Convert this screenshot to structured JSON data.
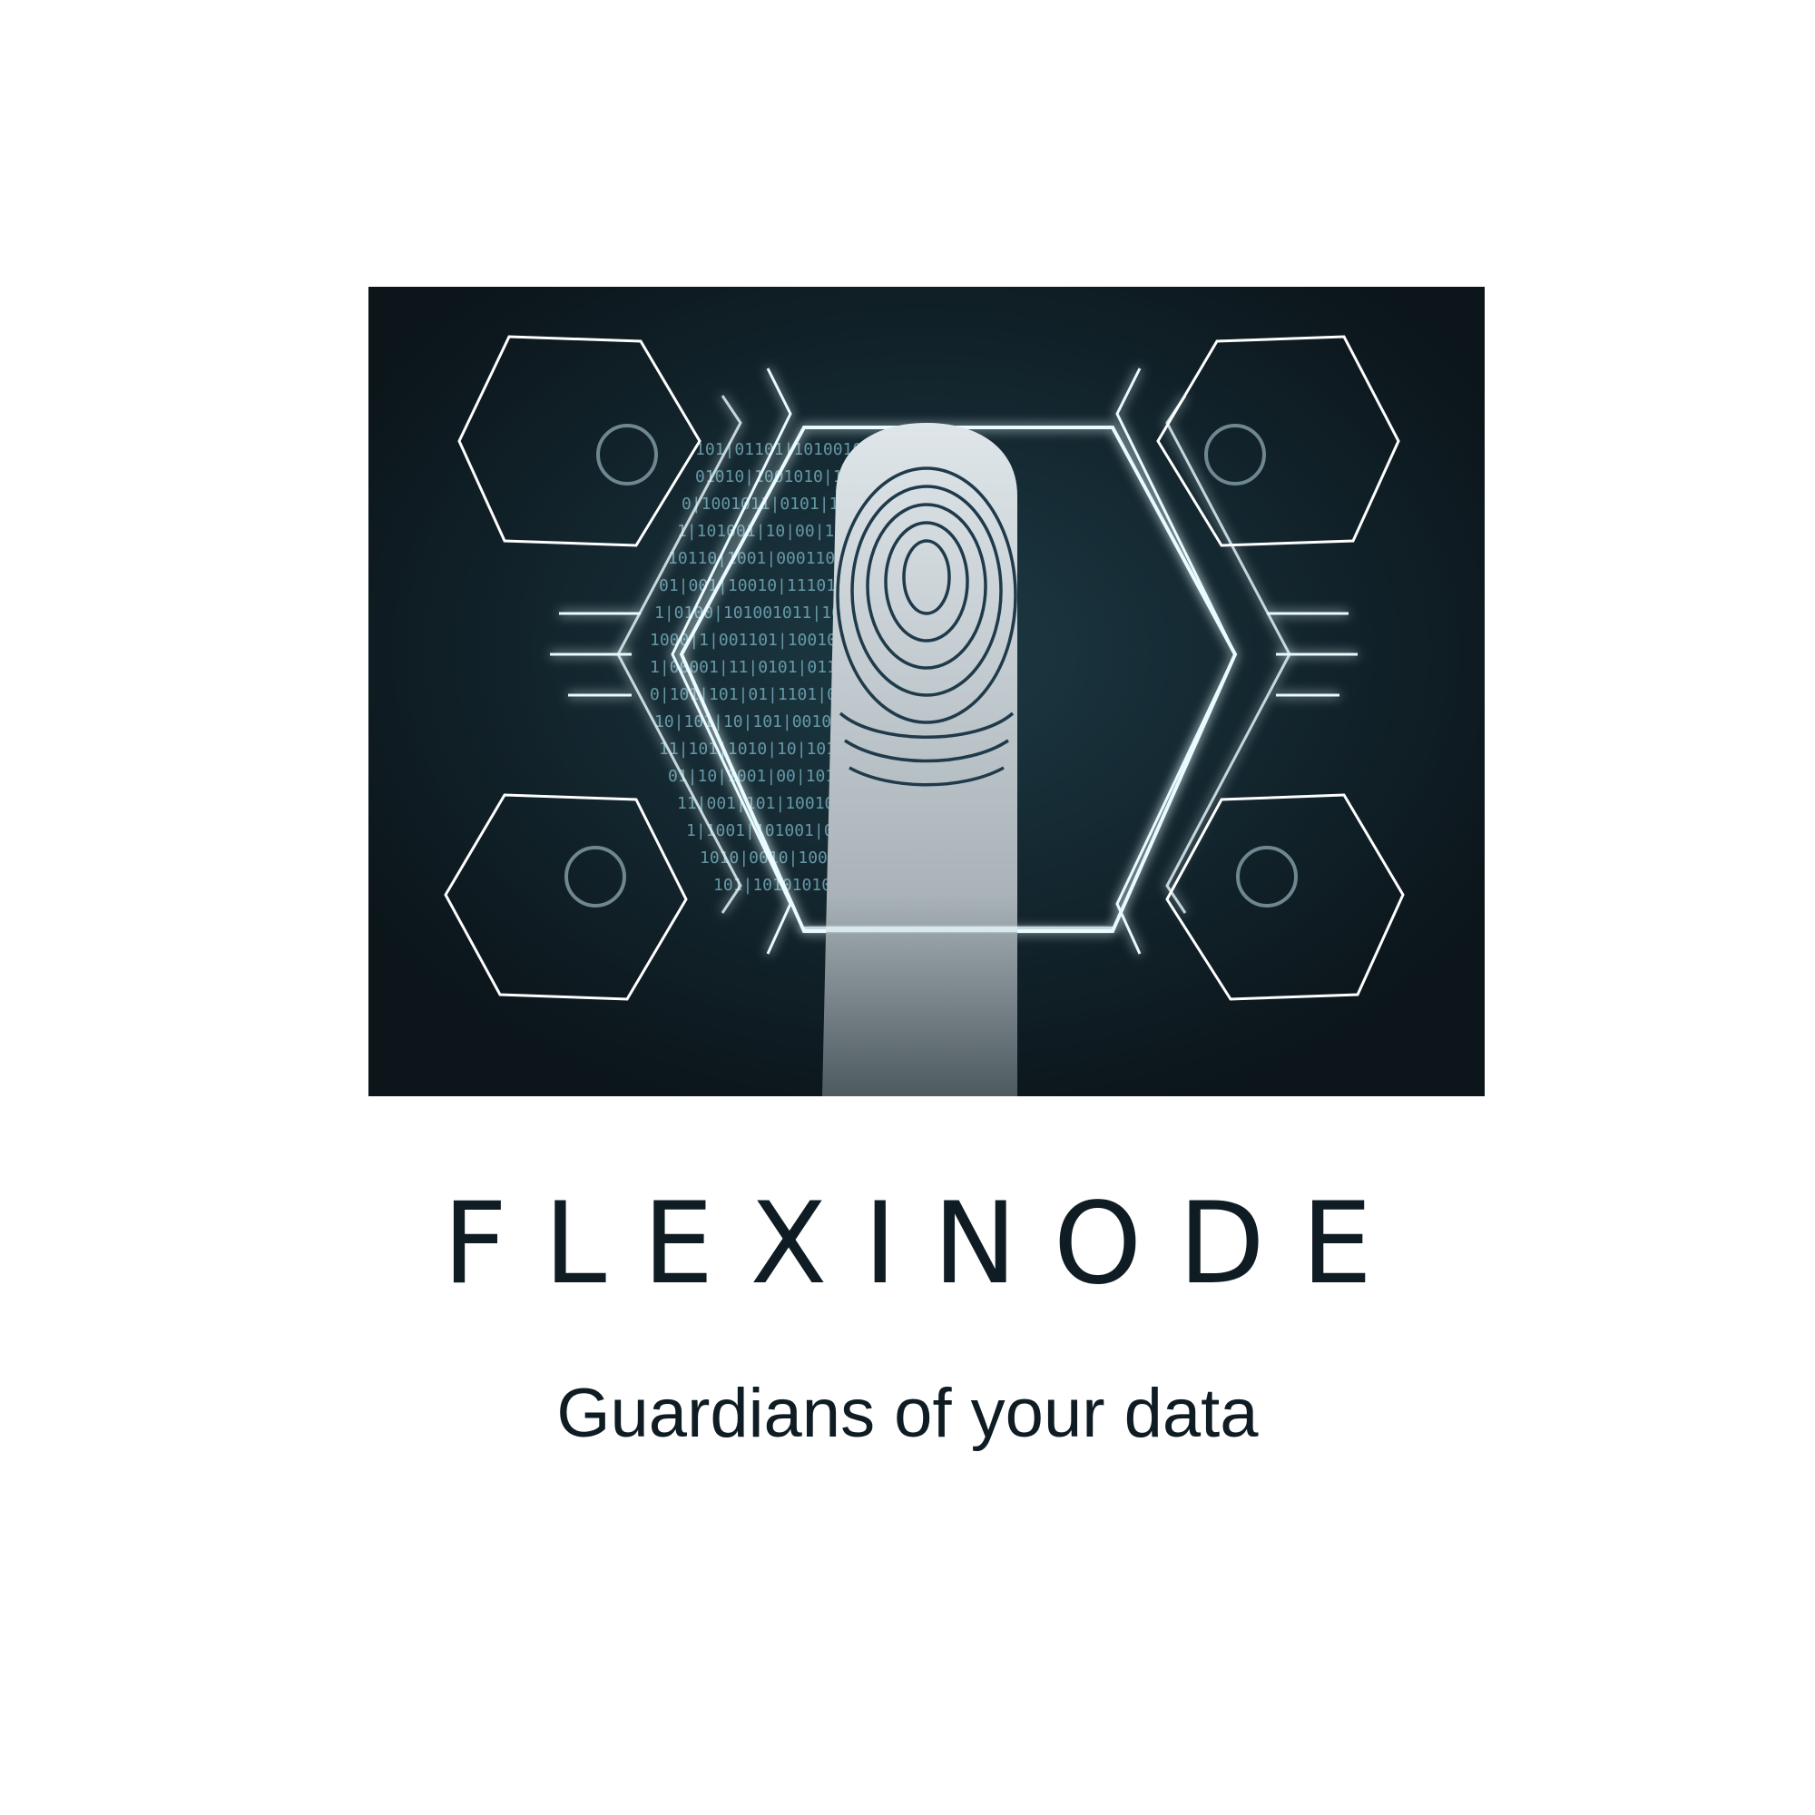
{
  "brand": {
    "name": "FLEXINODE",
    "tagline": "Guardians of your data"
  },
  "colors": {
    "background": "#ffffff",
    "text": "#0f1c23",
    "panel": "#0f1c23",
    "glow": "#6fd6f2"
  },
  "hero": {
    "icons": [
      "fingerprint-icon",
      "hexagon-frame-icon",
      "binary-code-pattern"
    ]
  }
}
